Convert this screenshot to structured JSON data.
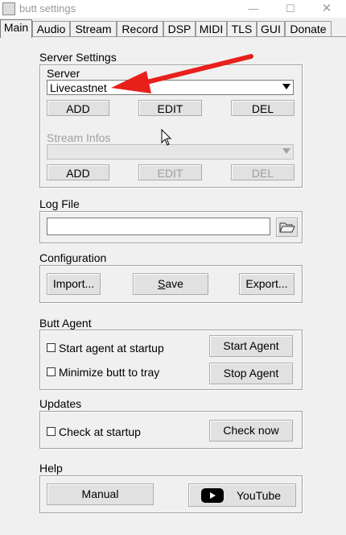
{
  "window": {
    "title": "butt settings",
    "minimize": "—",
    "maximize": "☐",
    "close": "✕"
  },
  "tabs": [
    "Main",
    "Audio",
    "Stream",
    "Record",
    "DSP",
    "MIDI",
    "TLS",
    "GUI",
    "Donate"
  ],
  "server_settings": {
    "heading": "Server Settings",
    "server_label": "Server",
    "server_value": "Livecastnet",
    "add": "ADD",
    "edit": "EDIT",
    "del": "DEL",
    "stream_infos_label": "Stream Infos",
    "stream_add": "ADD",
    "stream_edit": "EDIT",
    "stream_del": "DEL"
  },
  "log_file": {
    "heading": "Log File",
    "value": ""
  },
  "configuration": {
    "heading": "Configuration",
    "import": "Import...",
    "save": "Save",
    "export": "Export..."
  },
  "butt_agent": {
    "heading": "Butt Agent",
    "start_at_startup": "Start agent at startup",
    "minimize_to_tray": "Minimize butt to tray",
    "start_agent": "Start Agent",
    "stop_agent": "Stop Agent"
  },
  "updates": {
    "heading": "Updates",
    "check_at_startup": "Check at startup",
    "check_now": "Check now"
  },
  "help": {
    "heading": "Help",
    "manual": "Manual",
    "youtube": "YouTube"
  },
  "colors": {
    "annotation_arrow": "#e8201c"
  }
}
